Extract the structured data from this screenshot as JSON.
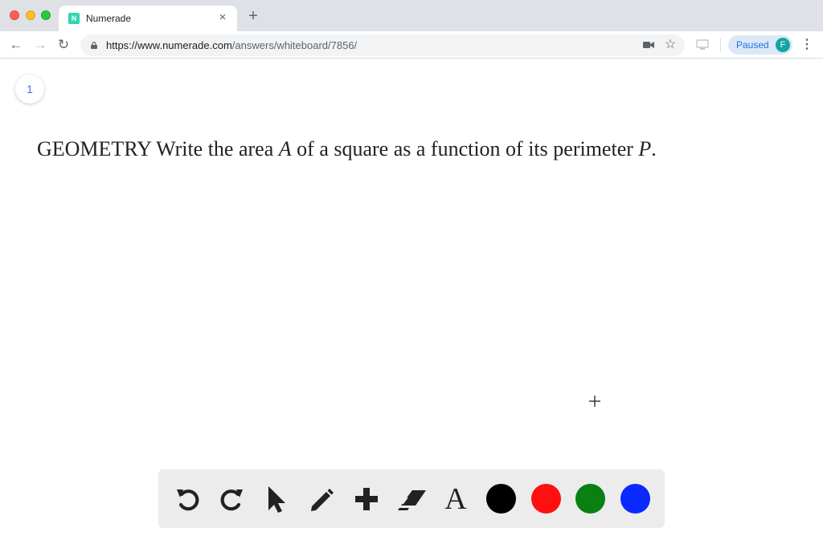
{
  "browser": {
    "tab": {
      "title": "Numerade",
      "favicon_letter": "N"
    },
    "url": {
      "scheme_host": "https://www.numerade.com",
      "path": "/answers/whiteboard/7856/"
    },
    "profile": {
      "status": "Paused",
      "avatar_initial": "F"
    }
  },
  "whiteboard": {
    "page_number": "1",
    "question": {
      "part1": "GEOMETRY Write the area ",
      "var_area": "A",
      "part2": " of a square as a function of its perimeter ",
      "var_perimeter": "P",
      "part3": "."
    }
  },
  "tools": {
    "items": [
      "undo-icon",
      "redo-icon",
      "pointer-icon",
      "pencil-icon",
      "plus-icon",
      "eraser-icon",
      "text-icon"
    ],
    "text_tool_glyph": "A",
    "colors": [
      "#000000",
      "#ff1010",
      "#0a7f12",
      "#0a28ff"
    ]
  },
  "theme": {
    "accent": "#1a73e8",
    "favicon": "#2fd6b0",
    "avatar": "#12a5a0",
    "page_badge_text": "#4a6fd8"
  }
}
